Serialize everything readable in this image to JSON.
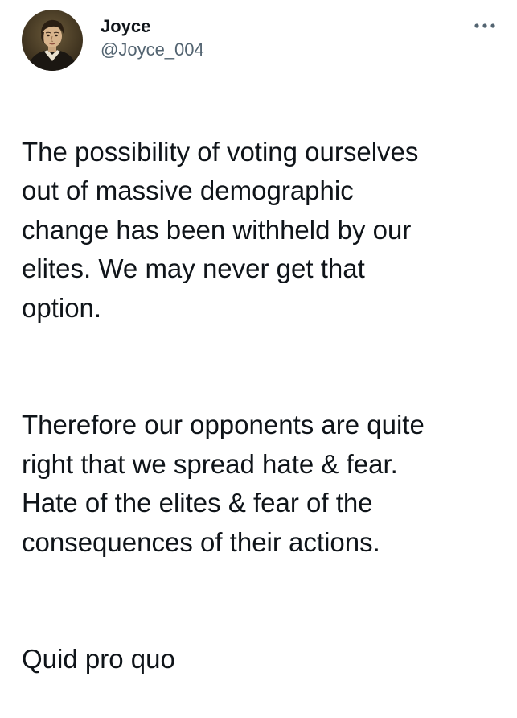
{
  "tweet": {
    "author": {
      "display_name": "Joyce",
      "handle": "@Joyce_004",
      "avatar_icon": "portrait-avatar"
    },
    "more_icon": "more-options-icon",
    "paragraphs": [
      "The possibility of voting ourselves\nout of massive demographic\nchange has been withheld by our\nelites. We may never get that\noption.",
      "Therefore our opponents are quite\nright that we spread hate & fear.\nHate of the elites & fear of the\nconsequences of their actions.",
      "Quid pro quo"
    ]
  },
  "colors": {
    "text_primary": "#0f1419",
    "text_secondary": "#536471",
    "background": "#ffffff"
  }
}
